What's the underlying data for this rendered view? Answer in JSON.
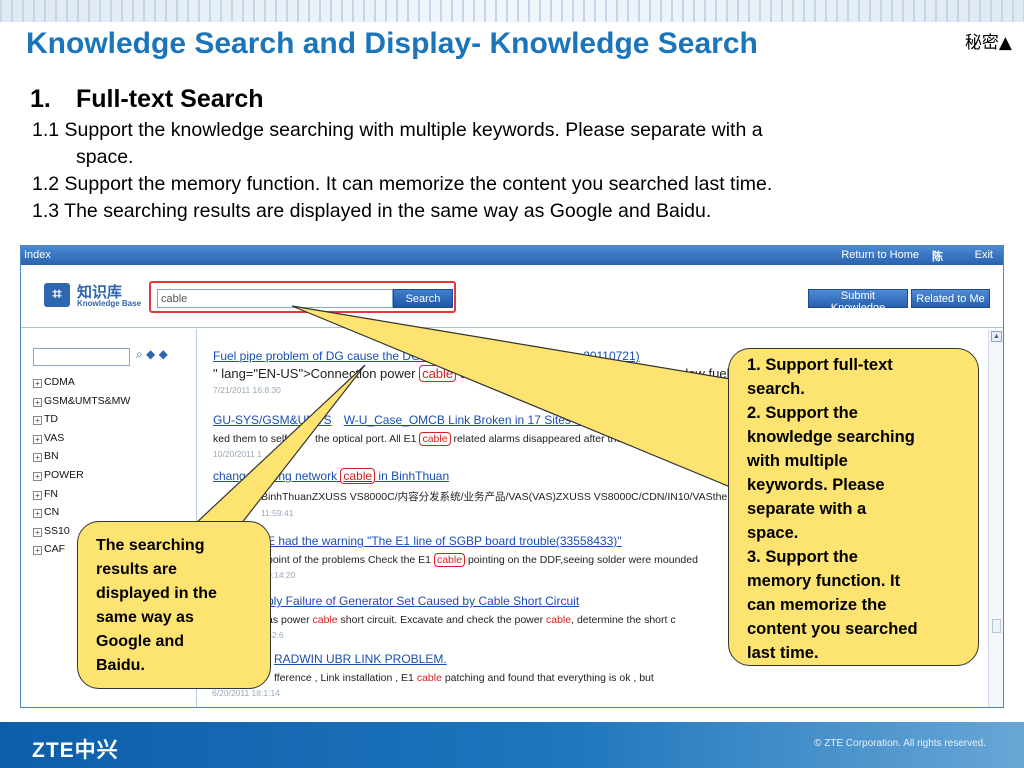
{
  "slide": {
    "title": "Knowledge Search and Display- Knowledge Search",
    "secret": "秘密▲",
    "heading_num": "1.",
    "heading": "Full-text Search",
    "bullets": [
      "1.1 Support the knowledge searching with multiple keywords. Please separate with a",
      "space.",
      "1.2 Support the memory function. It can memorize the content you searched last time.",
      "1.3  The searching results are displayed in the same way as Google and Baidu."
    ]
  },
  "app": {
    "topbar": {
      "index": "Index",
      "home": "Return to Home",
      "user": "陈",
      "exit": "Exit"
    },
    "logo": {
      "zh": "知识库",
      "en": "Knowledge Base"
    },
    "search": {
      "value": "cable",
      "button": "Search"
    },
    "buttons": {
      "submit": "Submit Knowledge",
      "related": "Related to Me"
    },
    "tree_tools": "⌕ ◆ ◆",
    "tree": [
      "CDMA",
      "GSM&UMTS&MW",
      "TD",
      "VAS",
      "BN",
      "POWER",
      "FN",
      "CN",
      "SS10",
      "CAF"
    ],
    "results": [
      {
        "title": "Fuel pipe problem of DG cause the DG c",
        "title_tail": "hujun-20110721)",
        "snippet_pre": "\" lang=\"EN-US\">Connection power ",
        "keyword": "cable",
        "snippet_post": " of low",
        "snippet_tail": "the low fuel pur",
        "date": "7/21/2011 16:8:30"
      },
      {
        "title": "GU-SYS/GSM&UMTS",
        "title_mid": "W-U_Case_OMCB Link Broken in 17 Sites du",
        "snippet_pre": "ked them to self-l",
        "snippet_mid": "the optical port. All E1 ",
        "keyword": "cable",
        "snippet_post": " related alarms disappeared after the",
        "date": "10/20/2011 1"
      },
      {
        "title_pre": "chang",
        "title": "rong network ",
        "keyword": "cable",
        "title_post": " in BinhThuan",
        "snippet": "BinhThuanZXUSS VS8000C/内容分发系统/业务产品/VAS(VAS)ZXUSS VS8000C/CDN/IN10/VASthe netw",
        "date": "11:59:41"
      },
      {
        "title": "E had the warning \"The E1 line of SGBP board trouble(33558433)\"",
        "snippet_pre": "point of the problems Check the E1 ",
        "keyword": "cable",
        "snippet_post": " pointing on the DDF,seeing solder were mounded",
        "date": "0:14:20"
      },
      {
        "title": "ply Failure of Generator Set Caused by Cable Short Circuit",
        "snippet_pre": "as power ",
        "keyword": "cable",
        "snippet_mid": " short circuit. Excavate and check the power ",
        "keyword2": "cable",
        "snippet_post": ", determine the short c",
        "date": "52:6"
      },
      {
        "title": "RADWIN UBR LINK PROBLEM.",
        "snippet_pre": "fference , Link installation , E1 ",
        "keyword": "cable",
        "snippet_post": " patching and found that everything is ok , but",
        "date": "6/20/2011 18:1:14"
      }
    ]
  },
  "callouts": {
    "right": [
      "1. Support full-text",
      "search.",
      "2. Support the",
      "knowledge searching",
      "with multiple",
      "keywords. Please",
      "separate with a",
      "space.",
      "3. Support the",
      "memory function. It",
      "can memorize the",
      "content you searched",
      "last time."
    ],
    "left": [
      "The searching",
      "results are",
      "displayed in the",
      "same way as",
      "Google and",
      "Baidu."
    ]
  },
  "footer": {
    "logo": "ZTE中兴",
    "copyright": "© ZTE Corporation. All rights reserved."
  },
  "colors": {
    "title_blue": "#1b75bb",
    "callout_yellow": "#fde36f",
    "highlight_red": "#d42020",
    "footer_blue": "#0d5ea9"
  }
}
